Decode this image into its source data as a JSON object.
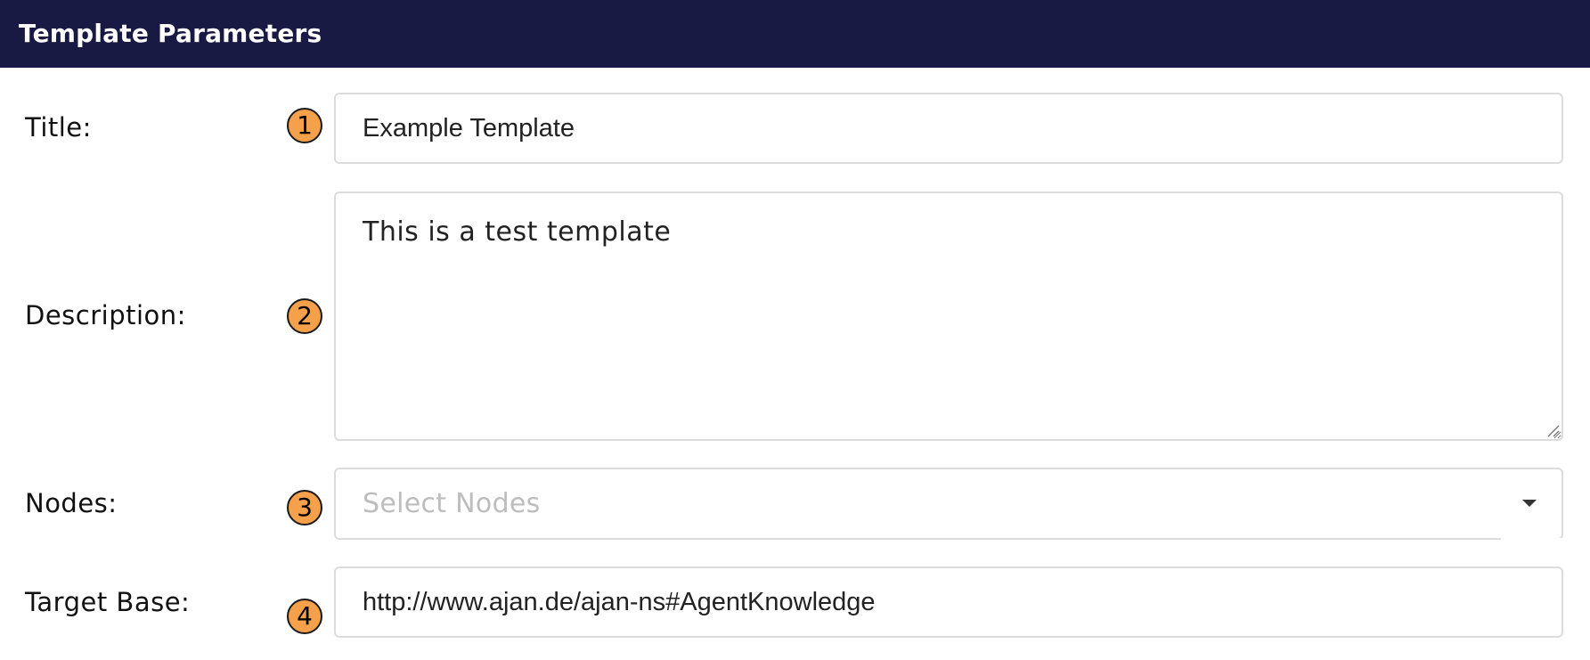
{
  "header": {
    "title": "Template Parameters"
  },
  "fields": {
    "title": {
      "label": "Title:",
      "badge": "1",
      "value": "Example Template"
    },
    "description": {
      "label": "Description:",
      "badge": "2",
      "value": "This is a test template"
    },
    "nodes": {
      "label": "Nodes:",
      "badge": "3",
      "placeholder": "Select Nodes",
      "icon": "chevron-down-icon"
    },
    "target_base": {
      "label": "Target Base:",
      "badge": "4",
      "value": "http://www.ajan.de/ajan-ns#AgentKnowledge"
    }
  },
  "colors": {
    "header_bg": "#181a44",
    "badge_bg": "#f5a04a",
    "field_border": "#dcdcdc",
    "placeholder": "#bdbdbd"
  }
}
